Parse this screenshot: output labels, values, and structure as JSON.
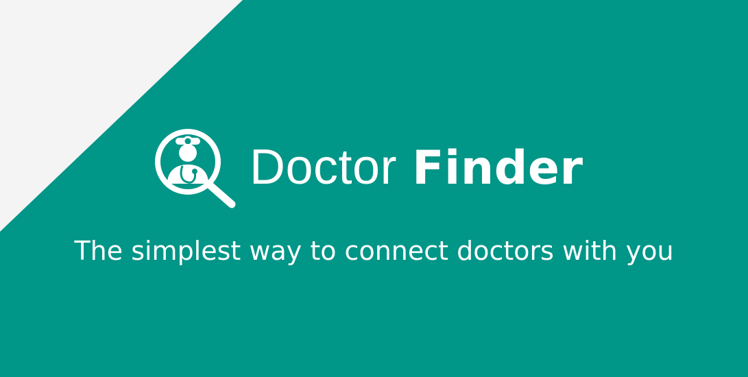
{
  "colors": {
    "primary": "#009688",
    "corner": "#f4f4f4",
    "text": "#ffffff"
  },
  "brand": {
    "icon": "doctor-search-icon",
    "word_light": "Doctor",
    "word_bold": "Finder"
  },
  "tagline": "The simplest way to connect doctors with you"
}
